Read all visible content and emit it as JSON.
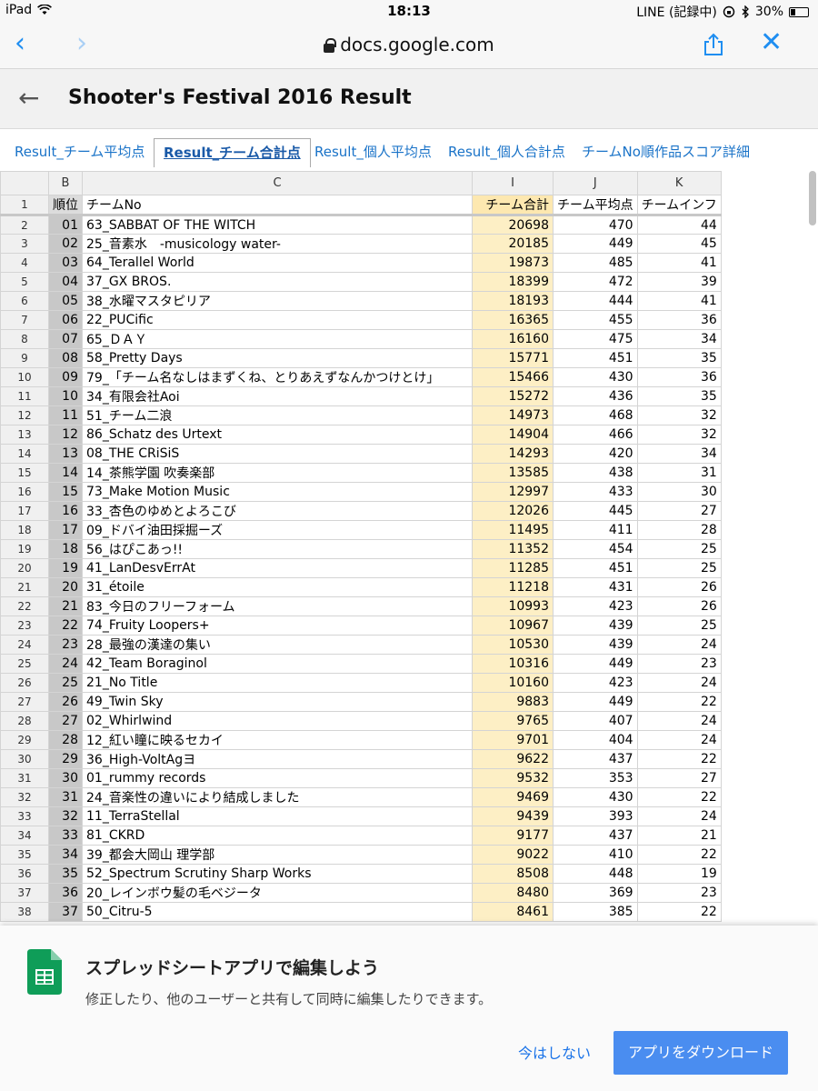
{
  "status": {
    "device": "iPad",
    "time": "18:13",
    "line_status": "LINE (記録中)",
    "battery_text": "30%",
    "battery_level": 0.3
  },
  "browser": {
    "back_glyph": "‹",
    "forward_glyph": "›",
    "url": "docs.google.com",
    "close_glyph": "✕"
  },
  "doc": {
    "back_glyph": "←",
    "title": "Shooter's Festival 2016 Result"
  },
  "tabs": [
    {
      "label": "Result_チーム平均点"
    },
    {
      "label": "Result_チーム合計点"
    },
    {
      "label": "Result_個人平均点"
    },
    {
      "label": "Result_個人合計点"
    },
    {
      "label": "チームNo順作品スコア詳細"
    }
  ],
  "columns": [
    "B",
    "C",
    "I",
    "J",
    "K"
  ],
  "header_row": {
    "num": "1",
    "rank": "順位",
    "team": "チームNo",
    "total": "チーム合計",
    "avg": "チーム平均点",
    "inf": "チームインフ"
  },
  "rows": [
    {
      "num": "2",
      "rank": "01",
      "team": "63_SABBAT OF THE WITCH",
      "total": "20698",
      "avg": "470",
      "inf": "44"
    },
    {
      "num": "3",
      "rank": "02",
      "team": "25_音素水　-musicology water-",
      "total": "20185",
      "avg": "449",
      "inf": "45"
    },
    {
      "num": "4",
      "rank": "03",
      "team": "64_Terallel World",
      "total": "19873",
      "avg": "485",
      "inf": "41"
    },
    {
      "num": "5",
      "rank": "04",
      "team": "37_GX BROS.",
      "total": "18399",
      "avg": "472",
      "inf": "39"
    },
    {
      "num": "6",
      "rank": "05",
      "team": "38_水曜マスタピリア",
      "total": "18193",
      "avg": "444",
      "inf": "41"
    },
    {
      "num": "7",
      "rank": "06",
      "team": "22_PUCific",
      "total": "16365",
      "avg": "455",
      "inf": "36"
    },
    {
      "num": "8",
      "rank": "07",
      "team": "65_ＤＡＹ",
      "total": "16160",
      "avg": "475",
      "inf": "34"
    },
    {
      "num": "9",
      "rank": "08",
      "team": "58_Pretty Days",
      "total": "15771",
      "avg": "451",
      "inf": "35"
    },
    {
      "num": "10",
      "rank": "09",
      "team": "79_「チーム名なしはまずくね、とりあえずなんかつけとけ」",
      "total": "15466",
      "avg": "430",
      "inf": "36"
    },
    {
      "num": "11",
      "rank": "10",
      "team": "34_有限会社Aoi",
      "total": "15272",
      "avg": "436",
      "inf": "35"
    },
    {
      "num": "12",
      "rank": "11",
      "team": "51_チーム二浪",
      "total": "14973",
      "avg": "468",
      "inf": "32"
    },
    {
      "num": "13",
      "rank": "12",
      "team": "86_Schatz des Urtext",
      "total": "14904",
      "avg": "466",
      "inf": "32"
    },
    {
      "num": "14",
      "rank": "13",
      "team": "08_THE CRiSiS",
      "total": "14293",
      "avg": "420",
      "inf": "34"
    },
    {
      "num": "15",
      "rank": "14",
      "team": "14_茶熊学園 吹奏楽部",
      "total": "13585",
      "avg": "438",
      "inf": "31"
    },
    {
      "num": "16",
      "rank": "15",
      "team": "73_Make Motion Music",
      "total": "12997",
      "avg": "433",
      "inf": "30"
    },
    {
      "num": "17",
      "rank": "16",
      "team": "33_杏色のゆめとよろこび",
      "total": "12026",
      "avg": "445",
      "inf": "27"
    },
    {
      "num": "18",
      "rank": "17",
      "team": "09_ドバイ油田採掘ーズ",
      "total": "11495",
      "avg": "411",
      "inf": "28"
    },
    {
      "num": "19",
      "rank": "18",
      "team": "56_はぴこあっ!!",
      "total": "11352",
      "avg": "454",
      "inf": "25"
    },
    {
      "num": "20",
      "rank": "19",
      "team": "41_LanDesvErrAt",
      "total": "11285",
      "avg": "451",
      "inf": "25"
    },
    {
      "num": "21",
      "rank": "20",
      "team": "31_étoile",
      "total": "11218",
      "avg": "431",
      "inf": "26"
    },
    {
      "num": "22",
      "rank": "21",
      "team": "83_今日のフリーフォーム",
      "total": "10993",
      "avg": "423",
      "inf": "26"
    },
    {
      "num": "23",
      "rank": "22",
      "team": "74_Fruity Loopers+",
      "total": "10967",
      "avg": "439",
      "inf": "25"
    },
    {
      "num": "24",
      "rank": "23",
      "team": "28_最強の漢達の集い",
      "total": "10530",
      "avg": "439",
      "inf": "24"
    },
    {
      "num": "25",
      "rank": "24",
      "team": "42_Team Boraginol",
      "total": "10316",
      "avg": "449",
      "inf": "23"
    },
    {
      "num": "26",
      "rank": "25",
      "team": "21_No Title",
      "total": "10160",
      "avg": "423",
      "inf": "24"
    },
    {
      "num": "27",
      "rank": "26",
      "team": "49_Twin Sky",
      "total": "9883",
      "avg": "449",
      "inf": "22"
    },
    {
      "num": "28",
      "rank": "27",
      "team": "02_Whirlwind",
      "total": "9765",
      "avg": "407",
      "inf": "24"
    },
    {
      "num": "29",
      "rank": "28",
      "team": "12_紅い瞳に映るセカイ",
      "total": "9701",
      "avg": "404",
      "inf": "24"
    },
    {
      "num": "30",
      "rank": "29",
      "team": "36_High-VoltAgヨ",
      "total": "9622",
      "avg": "437",
      "inf": "22"
    },
    {
      "num": "31",
      "rank": "30",
      "team": "01_rummy records",
      "total": "9532",
      "avg": "353",
      "inf": "27"
    },
    {
      "num": "32",
      "rank": "31",
      "team": "24_音楽性の違いにより結成しました",
      "total": "9469",
      "avg": "430",
      "inf": "22"
    },
    {
      "num": "33",
      "rank": "32",
      "team": "11_TerraStellal",
      "total": "9439",
      "avg": "393",
      "inf": "24"
    },
    {
      "num": "34",
      "rank": "33",
      "team": "81_CKRD",
      "total": "9177",
      "avg": "437",
      "inf": "21"
    },
    {
      "num": "35",
      "rank": "34",
      "team": "39_都会大岡山 理学部",
      "total": "9022",
      "avg": "410",
      "inf": "22"
    },
    {
      "num": "36",
      "rank": "35",
      "team": "52_Spectrum Scrutiny Sharp Works",
      "total": "8508",
      "avg": "448",
      "inf": "19"
    },
    {
      "num": "37",
      "rank": "36",
      "team": "20_レインボウ髪の毛ベジータ",
      "total": "8480",
      "avg": "369",
      "inf": "23"
    },
    {
      "num": "38",
      "rank": "37",
      "team": "50_Citru-5",
      "total": "8461",
      "avg": "385",
      "inf": "22"
    }
  ],
  "promo": {
    "title": "スプレッドシートアプリで編集しよう",
    "description": "修正したり、他のユーザーと共有して同時に編集したりできます。",
    "later_label": "今はしない",
    "download_label": "アプリをダウンロード"
  },
  "colors": {
    "accent": "#1f8ef1",
    "total_column": "#fdefc5",
    "download_button": "#4a8df0",
    "sheets_green": "#0f9d58"
  }
}
